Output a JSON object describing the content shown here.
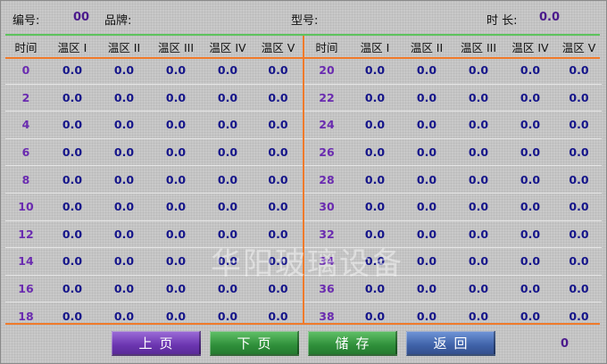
{
  "header": {
    "id_label": "编号:",
    "id_value": "00",
    "brand_label": "品牌:",
    "model_label": "型号:",
    "duration_label": "时 长:",
    "duration_value": "0.0"
  },
  "table": {
    "columns": [
      "时间",
      "温区 I",
      "温区 II",
      "温区 III",
      "温区 IV",
      "温区 V"
    ],
    "left_rows": [
      {
        "time": "0",
        "v": [
          "0.0",
          "0.0",
          "0.0",
          "0.0",
          "0.0"
        ]
      },
      {
        "time": "2",
        "v": [
          "0.0",
          "0.0",
          "0.0",
          "0.0",
          "0.0"
        ]
      },
      {
        "time": "4",
        "v": [
          "0.0",
          "0.0",
          "0.0",
          "0.0",
          "0.0"
        ]
      },
      {
        "time": "6",
        "v": [
          "0.0",
          "0.0",
          "0.0",
          "0.0",
          "0.0"
        ]
      },
      {
        "time": "8",
        "v": [
          "0.0",
          "0.0",
          "0.0",
          "0.0",
          "0.0"
        ]
      },
      {
        "time": "10",
        "v": [
          "0.0",
          "0.0",
          "0.0",
          "0.0",
          "0.0"
        ]
      },
      {
        "time": "12",
        "v": [
          "0.0",
          "0.0",
          "0.0",
          "0.0",
          "0.0"
        ]
      },
      {
        "time": "14",
        "v": [
          "0.0",
          "0.0",
          "0.0",
          "0.0",
          "0.0"
        ]
      },
      {
        "time": "16",
        "v": [
          "0.0",
          "0.0",
          "0.0",
          "0.0",
          "0.0"
        ]
      },
      {
        "time": "18",
        "v": [
          "0.0",
          "0.0",
          "0.0",
          "0.0",
          "0.0"
        ]
      }
    ],
    "right_rows": [
      {
        "time": "20",
        "v": [
          "0.0",
          "0.0",
          "0.0",
          "0.0",
          "0.0"
        ]
      },
      {
        "time": "22",
        "v": [
          "0.0",
          "0.0",
          "0.0",
          "0.0",
          "0.0"
        ]
      },
      {
        "time": "24",
        "v": [
          "0.0",
          "0.0",
          "0.0",
          "0.0",
          "0.0"
        ]
      },
      {
        "time": "26",
        "v": [
          "0.0",
          "0.0",
          "0.0",
          "0.0",
          "0.0"
        ]
      },
      {
        "time": "28",
        "v": [
          "0.0",
          "0.0",
          "0.0",
          "0.0",
          "0.0"
        ]
      },
      {
        "time": "30",
        "v": [
          "0.0",
          "0.0",
          "0.0",
          "0.0",
          "0.0"
        ]
      },
      {
        "time": "32",
        "v": [
          "0.0",
          "0.0",
          "0.0",
          "0.0",
          "0.0"
        ]
      },
      {
        "time": "34",
        "v": [
          "0.0",
          "0.0",
          "0.0",
          "0.0",
          "0.0"
        ]
      },
      {
        "time": "36",
        "v": [
          "0.0",
          "0.0",
          "0.0",
          "0.0",
          "0.0"
        ]
      },
      {
        "time": "38",
        "v": [
          "0.0",
          "0.0",
          "0.0",
          "0.0",
          "0.0"
        ]
      }
    ]
  },
  "buttons": {
    "prev": "上页",
    "next": "下页",
    "save": "储存",
    "back": "返回"
  },
  "page_number": "0",
  "watermark": "华阳玻璃设备",
  "colors": {
    "accent_green_line": "#5cc35c",
    "divider_orange": "#f07a2a",
    "time_purple": "#6a2bb0",
    "value_navy": "#15158a"
  }
}
